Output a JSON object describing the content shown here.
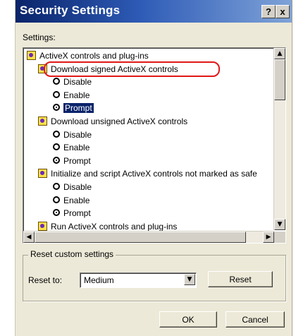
{
  "window": {
    "title": "Security Settings",
    "help_label": "?",
    "close_label": "x"
  },
  "settings_label": "Settings:",
  "tree": [
    {
      "kind": "group",
      "label": "ActiveX controls and plug-ins"
    },
    {
      "kind": "setting",
      "label": "Download signed ActiveX controls",
      "highlighted": true
    },
    {
      "kind": "option",
      "label": "Disable",
      "checked": false
    },
    {
      "kind": "option",
      "label": "Enable",
      "checked": false
    },
    {
      "kind": "option",
      "label": "Prompt",
      "checked": true,
      "selected": true
    },
    {
      "kind": "setting",
      "label": "Download unsigned ActiveX controls"
    },
    {
      "kind": "option",
      "label": "Disable",
      "checked": false
    },
    {
      "kind": "option",
      "label": "Enable",
      "checked": false
    },
    {
      "kind": "option",
      "label": "Prompt",
      "checked": true
    },
    {
      "kind": "setting",
      "label": "Initialize and script ActiveX controls not marked as safe"
    },
    {
      "kind": "option",
      "label": "Disable",
      "checked": false
    },
    {
      "kind": "option",
      "label": "Enable",
      "checked": false
    },
    {
      "kind": "option",
      "label": "Prompt",
      "checked": true
    },
    {
      "kind": "setting",
      "label": "Run ActiveX controls and plug-ins"
    }
  ],
  "reset_group": {
    "title": "Reset custom settings",
    "reset_to_label": "Reset to:",
    "reset_to_value": "Medium",
    "reset_button": "Reset"
  },
  "buttons": {
    "ok": "OK",
    "cancel": "Cancel"
  },
  "icons": {
    "scroll_up": "scroll-up-arrow",
    "scroll_down": "scroll-down-arrow",
    "scroll_left": "scroll-left-arrow",
    "scroll_right": "scroll-right-arrow",
    "dropdown": "chevron-down"
  },
  "colors": {
    "titlebar_start": "#0a246a",
    "titlebar_end": "#7fa3d8",
    "dialog_face": "#ece9d8",
    "callout": "#e01818",
    "selection": "#0a246a"
  }
}
